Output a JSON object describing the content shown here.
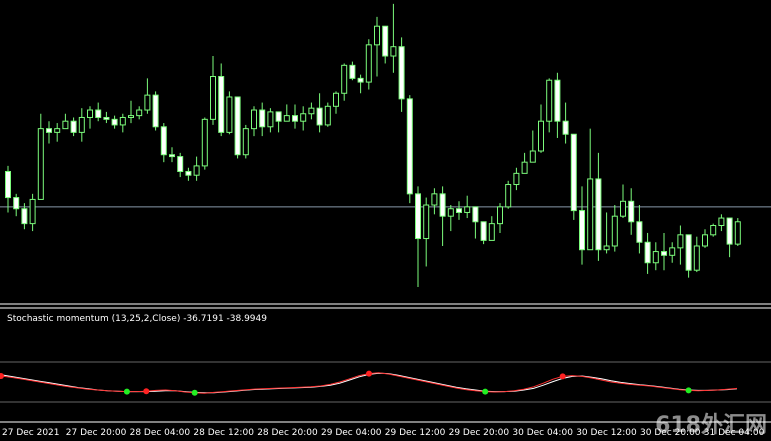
{
  "colors": {
    "background": "#000000",
    "candle_up_body": "#000000",
    "candle_up_outline": "#7cfc7c",
    "candle_down_body": "#ffffff",
    "candle_down_outline": "#7cfc7c",
    "wick": "#7cfc7c",
    "hline": "#8899aa",
    "separator": "#ffffff",
    "level_line": "#666666",
    "stoch_main": "#ff3333",
    "stoch_signal": "#ffffff",
    "dot_low": "#22ee22",
    "dot_high": "#ff2222",
    "text": "#ffffff"
  },
  "indicator": {
    "label": "Stochastic momentum (13,25,2,Close) -36.7191 -38.9949"
  },
  "time_axis": {
    "labels": [
      "27 Dec 2021",
      "27 Dec 20:00",
      "28 Dec 04:00",
      "28 Dec 12:00",
      "28 Dec 20:00",
      "29 Dec 04:00",
      "29 Dec 12:00",
      "29 Dec 20:00",
      "30 Dec 04:00",
      "30 Dec 12:00",
      "30 Dec 20:00",
      "31 Dec 04:00"
    ]
  },
  "watermark": "618外汇网",
  "chart_data": {
    "type": "candlestick",
    "ohlc": [
      [
        69,
        72,
        47,
        55
      ],
      [
        55,
        57,
        45,
        49
      ],
      [
        49,
        52,
        38,
        41
      ],
      [
        41,
        57,
        37,
        54
      ],
      [
        54,
        100,
        54,
        92
      ],
      [
        92,
        96,
        84,
        90
      ],
      [
        90,
        95,
        85,
        92
      ],
      [
        92,
        100,
        92,
        96
      ],
      [
        96,
        98,
        88,
        90
      ],
      [
        90,
        103,
        85,
        98
      ],
      [
        98,
        104,
        92,
        102
      ],
      [
        102,
        106,
        96,
        98
      ],
      [
        98,
        101,
        95,
        97
      ],
      [
        97,
        99,
        92,
        94
      ],
      [
        94,
        100,
        90,
        98
      ],
      [
        98,
        107,
        95,
        99
      ],
      [
        99,
        104,
        97,
        102
      ],
      [
        102,
        119,
        100,
        110
      ],
      [
        110,
        112,
        91,
        93
      ],
      [
        93,
        95,
        74,
        78
      ],
      [
        78,
        82,
        74,
        77
      ],
      [
        77,
        79,
        66,
        69
      ],
      [
        69,
        71,
        64,
        67
      ],
      [
        67,
        77,
        64,
        72
      ],
      [
        72,
        98,
        70,
        97
      ],
      [
        97,
        131,
        94,
        120
      ],
      [
        120,
        127,
        88,
        90
      ],
      [
        90,
        112,
        89,
        109
      ],
      [
        109,
        106,
        76,
        78
      ],
      [
        78,
        94,
        76,
        92
      ],
      [
        92,
        104,
        88,
        102
      ],
      [
        102,
        106,
        88,
        93
      ],
      [
        93,
        103,
        90,
        101
      ],
      [
        101,
        99,
        90,
        96
      ],
      [
        96,
        105,
        96,
        99
      ],
      [
        99,
        105,
        92,
        96
      ],
      [
        96,
        104,
        91,
        100
      ],
      [
        100,
        106,
        97,
        103
      ],
      [
        103,
        111,
        90,
        94
      ],
      [
        94,
        106,
        93,
        104
      ],
      [
        104,
        112,
        100,
        111
      ],
      [
        111,
        127,
        107,
        126
      ],
      [
        126,
        128,
        118,
        119
      ],
      [
        119,
        121,
        111,
        117
      ],
      [
        117,
        140,
        113,
        137
      ],
      [
        137,
        152,
        120,
        147
      ],
      [
        147,
        144,
        127,
        131
      ],
      [
        131,
        159,
        122,
        136
      ],
      [
        136,
        141,
        101,
        108
      ],
      [
        108,
        110,
        52,
        57
      ],
      [
        57,
        61,
        7,
        33
      ],
      [
        33,
        55,
        18,
        51
      ],
      [
        51,
        60,
        46,
        57
      ],
      [
        57,
        61,
        29,
        45
      ],
      [
        45,
        51,
        37,
        49
      ],
      [
        49,
        53,
        43,
        47
      ],
      [
        47,
        56,
        44,
        50
      ],
      [
        50,
        47,
        33,
        42
      ],
      [
        42,
        38,
        30,
        32
      ],
      [
        32,
        45,
        32,
        41
      ],
      [
        41,
        52,
        36,
        50
      ],
      [
        50,
        64,
        49,
        62
      ],
      [
        62,
        71,
        59,
        68
      ],
      [
        68,
        79,
        68,
        74
      ],
      [
        74,
        91,
        74,
        80
      ],
      [
        80,
        105,
        79,
        96
      ],
      [
        96,
        119,
        90,
        118
      ],
      [
        118,
        122,
        87,
        96
      ],
      [
        96,
        106,
        84,
        89
      ],
      [
        89,
        88,
        43,
        48
      ],
      [
        48,
        61,
        19,
        27
      ],
      [
        27,
        92,
        27,
        65
      ],
      [
        65,
        79,
        21,
        27
      ],
      [
        27,
        47,
        25,
        29
      ],
      [
        29,
        51,
        26,
        45
      ],
      [
        45,
        62,
        44,
        53
      ],
      [
        53,
        60,
        35,
        42
      ],
      [
        42,
        51,
        25,
        31
      ],
      [
        31,
        36,
        14,
        20
      ],
      [
        20,
        31,
        16,
        26
      ],
      [
        26,
        36,
        16,
        24
      ],
      [
        24,
        31,
        20,
        28
      ],
      [
        28,
        40,
        19,
        35
      ],
      [
        35,
        31,
        12,
        16
      ],
      [
        16,
        34,
        15,
        29
      ],
      [
        29,
        38,
        28,
        35
      ],
      [
        35,
        41,
        34,
        40
      ],
      [
        40,
        46,
        37,
        44
      ],
      [
        44,
        43,
        23,
        30
      ],
      [
        30,
        44,
        29,
        42
      ]
    ],
    "price_line": 50,
    "stoch_main": [
      -15,
      -18,
      -22,
      -26,
      -30,
      -34,
      -38,
      -42,
      -45,
      -48,
      -50,
      -52,
      -53,
      -54,
      -54,
      -53,
      -51,
      -50,
      -52,
      -55,
      -57,
      -58,
      -56,
      -54,
      -52,
      -50,
      -48,
      -47,
      -46,
      -45,
      -44,
      -43,
      -42,
      -40,
      -36,
      -30,
      -22,
      -14,
      -9,
      -7,
      -10,
      -15,
      -20,
      -25,
      -30,
      -35,
      -40,
      -45,
      -49,
      -52,
      -54,
      -55,
      -54,
      -52,
      -48,
      -42,
      -33,
      -23,
      -16,
      -14,
      -16,
      -20,
      -25,
      -30,
      -33,
      -36,
      -38,
      -40,
      -43,
      -46,
      -49,
      -51,
      -52,
      -51,
      -50,
      -48,
      -46
    ],
    "stoch_signal": [
      -12,
      -16,
      -20,
      -24,
      -28,
      -32,
      -36,
      -40,
      -44,
      -47,
      -50,
      -52,
      -53,
      -54,
      -54,
      -54,
      -53,
      -52,
      -52,
      -54,
      -56,
      -57,
      -57,
      -55,
      -53,
      -51,
      -49,
      -48,
      -47,
      -46,
      -45,
      -44,
      -43,
      -41,
      -38,
      -33,
      -25,
      -17,
      -11,
      -8,
      -9,
      -13,
      -18,
      -23,
      -28,
      -33,
      -38,
      -43,
      -47,
      -50,
      -53,
      -54,
      -54,
      -53,
      -50,
      -46,
      -38,
      -29,
      -21,
      -16,
      -15,
      -18,
      -22,
      -27,
      -31,
      -34,
      -37,
      -39,
      -42,
      -45,
      -48,
      -50,
      -51,
      -51,
      -50,
      -49,
      -47
    ],
    "dots": [
      {
        "i": 0,
        "kind": "high"
      },
      {
        "i": 13,
        "kind": "low"
      },
      {
        "i": 15,
        "kind": "high"
      },
      {
        "i": 20,
        "kind": "low"
      },
      {
        "i": 38,
        "kind": "high"
      },
      {
        "i": 50,
        "kind": "low"
      },
      {
        "i": 58,
        "kind": "high"
      },
      {
        "i": 71,
        "kind": "low"
      }
    ],
    "levels": [
      -80,
      20
    ]
  }
}
